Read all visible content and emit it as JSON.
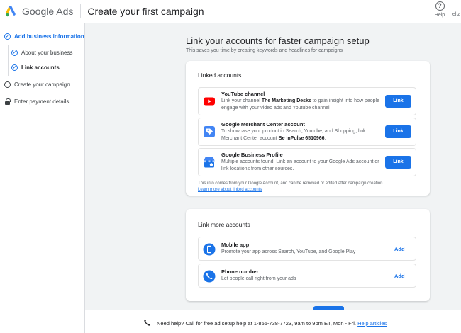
{
  "header": {
    "brand": "Google Ads",
    "title": "Create your first campaign",
    "help_label": "Help",
    "user": "eliz"
  },
  "sidebar": {
    "steps": [
      {
        "label": "Add business information",
        "state": "active"
      },
      {
        "label": "About your business",
        "state": "done"
      },
      {
        "label": "Link accounts",
        "state": "current"
      },
      {
        "label": "Create your campaign",
        "state": "todo"
      },
      {
        "label": "Enter payment details",
        "state": "locked"
      }
    ]
  },
  "main": {
    "title": "Link your accounts for faster campaign setup",
    "subtitle": "This saves you time by creating keywords and headlines for campaigns",
    "linked": {
      "title": "Linked accounts",
      "items": [
        {
          "title": "YouTube channel",
          "desc_pre": "Link your channel ",
          "desc_bold": "The Marketing Desks",
          "desc_post": " to gain insight into how people engage with your video ads and Youtube channel",
          "button": "Link",
          "icon": "youtube-icon"
        },
        {
          "title": "Google Merchant Center account",
          "desc_pre": "To showcase your product in Search, Youtube, and Shopping, link Merchant Center account ",
          "desc_bold": "Be InPulse 6510966",
          "desc_post": ".",
          "button": "Link",
          "icon": "merchant-center-icon"
        },
        {
          "title": "Google Business Profile",
          "desc_pre": "Multiple accounts found. Link an account to your Google Ads account or link locations from other sources.",
          "desc_bold": "",
          "desc_post": "",
          "button": "Link",
          "icon": "business-profile-icon"
        }
      ],
      "note": "This info comes from your Google Account, and can be removed or edited after campaign creation.",
      "note_link": "Learn more about linked accounts"
    },
    "more": {
      "title": "Link more accounts",
      "items": [
        {
          "title": "Mobile app",
          "desc": "Promote your app across Search, YouTube, and Google Play",
          "button": "Add",
          "icon": "mobile-app-icon"
        },
        {
          "title": "Phone number",
          "desc": "Let people call right from your ads",
          "button": "Add",
          "icon": "phone-number-icon"
        }
      ]
    }
  },
  "footer": {
    "text": "Need help? Call for free ad setup help at 1-855-738-7723, 9am to 9pm ET, Mon - Fri.",
    "link": "Help articles"
  },
  "colors": {
    "accent": "#1a73e8",
    "youtube": "#ff0000",
    "text": "#202124",
    "muted": "#5f6368"
  }
}
